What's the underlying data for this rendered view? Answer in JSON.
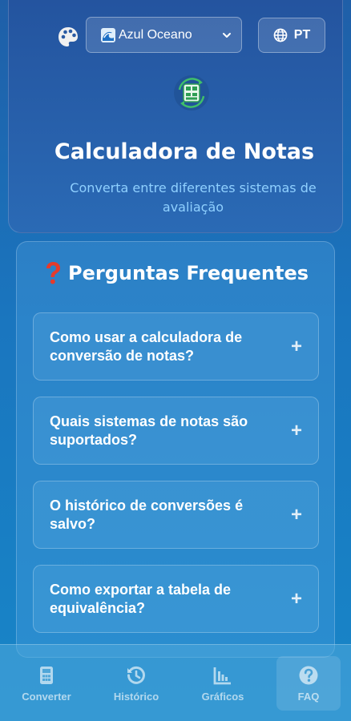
{
  "header": {
    "palette_icon": "palette-icon",
    "theme_select": {
      "value": "Azul Oceano",
      "icon": "wave-icon"
    },
    "language_button": {
      "label": "PT",
      "icon": "globe-icon"
    },
    "app_icon": "calculator-convert-icon",
    "title": "Calculadora de Notas",
    "subtitle": "Converta entre diferentes sistemas de avaliação"
  },
  "faq": {
    "icon": "question-mark-icon",
    "title": "Perguntas Frequentes",
    "items": [
      {
        "question": "Como usar a calculadora de conversão de notas?",
        "toggle": "+"
      },
      {
        "question": "Quais sistemas de notas são suportados?",
        "toggle": "+"
      },
      {
        "question": "O histórico de conversões é salvo?",
        "toggle": "+"
      },
      {
        "question": "Como exportar a tabela de equivalência?",
        "toggle": "+"
      }
    ]
  },
  "nav": {
    "items": [
      {
        "label": "Converter",
        "icon": "calculator-icon"
      },
      {
        "label": "Histórico",
        "icon": "history-icon"
      },
      {
        "label": "Gráficos",
        "icon": "chart-icon"
      },
      {
        "label": "FAQ",
        "icon": "help-circle-icon",
        "active": true
      }
    ]
  },
  "colors": {
    "subtitle": "#8fd0ff",
    "accent_green": "#3fbf6a",
    "question_red": "#e53b2c"
  }
}
